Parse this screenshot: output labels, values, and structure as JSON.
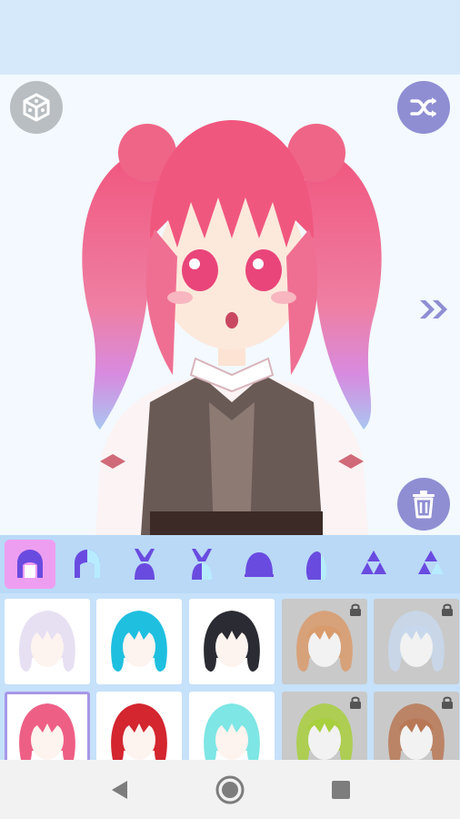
{
  "app": {
    "accent": "#8f8ed3",
    "tab_bar_color": "#b9d9f7",
    "active_tab_color": "#ee9ef1"
  },
  "stage": {
    "left_button_icon": "dice-icon",
    "right_button_icon": "shuffle-icon",
    "next_icon": "double-chevron-right-icon",
    "delete_icon": "trash-icon"
  },
  "tabs": [
    {
      "icon": "front-hair-icon",
      "active": true
    },
    {
      "icon": "front-hair-alt-icon",
      "active": false
    },
    {
      "icon": "bunny-ears-icon",
      "active": false
    },
    {
      "icon": "bunny-ears-alt-icon",
      "active": false
    },
    {
      "icon": "bun-icon",
      "active": false
    },
    {
      "icon": "side-hair-icon",
      "active": false
    },
    {
      "icon": "triangle-pattern-icon",
      "active": false
    },
    {
      "icon": "triangle-pattern-alt-icon",
      "active": false
    }
  ],
  "hair_options": [
    {
      "color": "#e7e0f3",
      "locked": false,
      "selected": false
    },
    {
      "color": "#1fbfe0",
      "locked": false,
      "selected": false
    },
    {
      "color": "#2b2b33",
      "locked": false,
      "selected": false
    },
    {
      "color": "#d99b6c",
      "locked": true,
      "selected": false
    },
    {
      "color": "#c8d8ec",
      "locked": true,
      "selected": false
    },
    {
      "color": "#ee5f86",
      "locked": false,
      "selected": true
    },
    {
      "color": "#d3262f",
      "locked": false,
      "selected": false
    },
    {
      "color": "#7ee6e4",
      "locked": false,
      "selected": false
    },
    {
      "color": "#a8cf3e",
      "locked": true,
      "selected": false
    },
    {
      "color": "#b97855",
      "locked": true,
      "selected": false
    }
  ],
  "nav": {
    "back_icon": "back-triangle-icon",
    "home_icon": "home-circle-icon",
    "recents_icon": "recents-square-icon"
  }
}
